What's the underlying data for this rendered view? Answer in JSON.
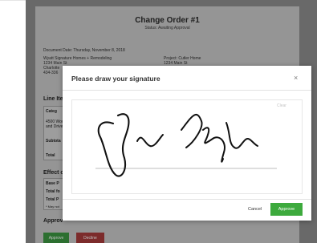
{
  "document": {
    "title": "Change Order #1",
    "status": "Status: Awaiting Approval",
    "date": "Document Date: Thursday, November 8, 2018",
    "client_name": "Wyatt Signature Homes + Remodeling",
    "client_street": "1234 Main St",
    "client_city": "Charlotte",
    "client_phone": "434-336",
    "project_label": "Project: Cutler Home",
    "project_street": "1234 Main St",
    "line_items_heading": "Line Ite",
    "line_items_table": {
      "header": "Categ",
      "row_text_1": "4500 Wood",
      "row_text_2": "and Drive",
      "subtotal": "Subtota",
      "total": "Total"
    },
    "effect_heading": "Effect o",
    "effect_table": {
      "row_1": "Base P",
      "row_2": "Total fo",
      "row_3": "Total P",
      "footnote": "* May not"
    },
    "approval_heading": "Approv",
    "approve_button": "Approve",
    "decline_button": "Decline"
  },
  "modal": {
    "title": "Please draw your signature",
    "close_glyph": "×",
    "clear_label": "Clear",
    "cancel_label": "Cancel",
    "approve_label": "Approve"
  },
  "colors": {
    "approve_green": "#3daa3d",
    "doc_approve_green": "#3b9440",
    "decline_red": "#a63a3a"
  }
}
